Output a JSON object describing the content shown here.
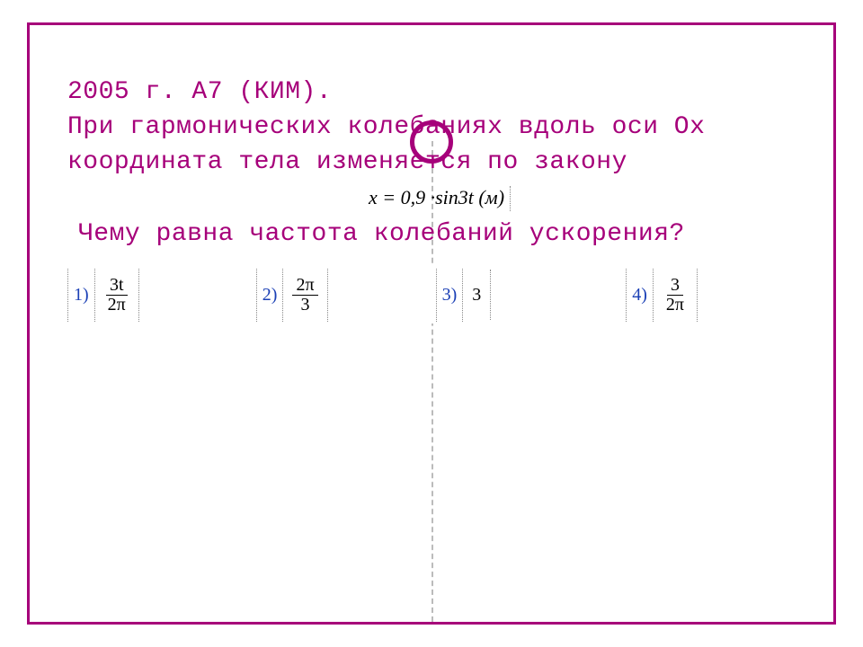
{
  "header": "2005 г. А7 (КИМ).",
  "prompt_line1": "При гармонических колебаниях вдоль оси Ох",
  "prompt_line2": "координата тела изменяется по закону",
  "equation": "x = 0,9 ·sin3t (м)",
  "question": "Чему равна частота колебаний ускорения?",
  "answers": [
    {
      "n": "1)",
      "type": "frac",
      "num": "3t",
      "den": "2π"
    },
    {
      "n": "2)",
      "type": "frac",
      "num": "2π",
      "den": "3"
    },
    {
      "n": "3)",
      "type": "plain",
      "val": "3"
    },
    {
      "n": "4)",
      "type": "frac",
      "num": "3",
      "den": "2π"
    }
  ],
  "colors": {
    "accent": "#a6007a",
    "link": "#1a3fb5"
  }
}
